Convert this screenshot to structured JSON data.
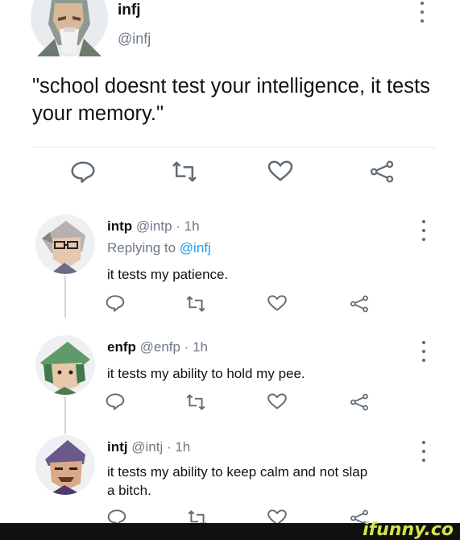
{
  "post": {
    "name": "infj",
    "handle": "@infj",
    "text": "\"school doesnt test your intelligence, it tests your memory.\""
  },
  "replies": [
    {
      "name": "intp",
      "handle": "@intp",
      "time": "· 1h",
      "replying_prefix": "Replying to",
      "replying_handle": "@infj",
      "text": "it tests my patience."
    },
    {
      "name": "enfp",
      "handle": "@enfp",
      "time": "· 1h",
      "text": "it tests my ability to hold my pee."
    },
    {
      "name": "intj",
      "handle": "@intj",
      "time": "· 1h",
      "text_line1": "it tests my ability to keep calm and not slap",
      "text_line2": "a bitch."
    }
  ],
  "icons": {
    "reply": "comment-bubble-icon",
    "retweet": "retweet-icon",
    "like": "heart-icon",
    "share": "share-icon",
    "more": "more-vertical-icon"
  },
  "colors": {
    "icon_gray": "#5f6b75",
    "handle_gray": "#6e7a86",
    "watermark": "#d4e34a"
  },
  "watermark": {
    "text": "ifunny.co"
  }
}
